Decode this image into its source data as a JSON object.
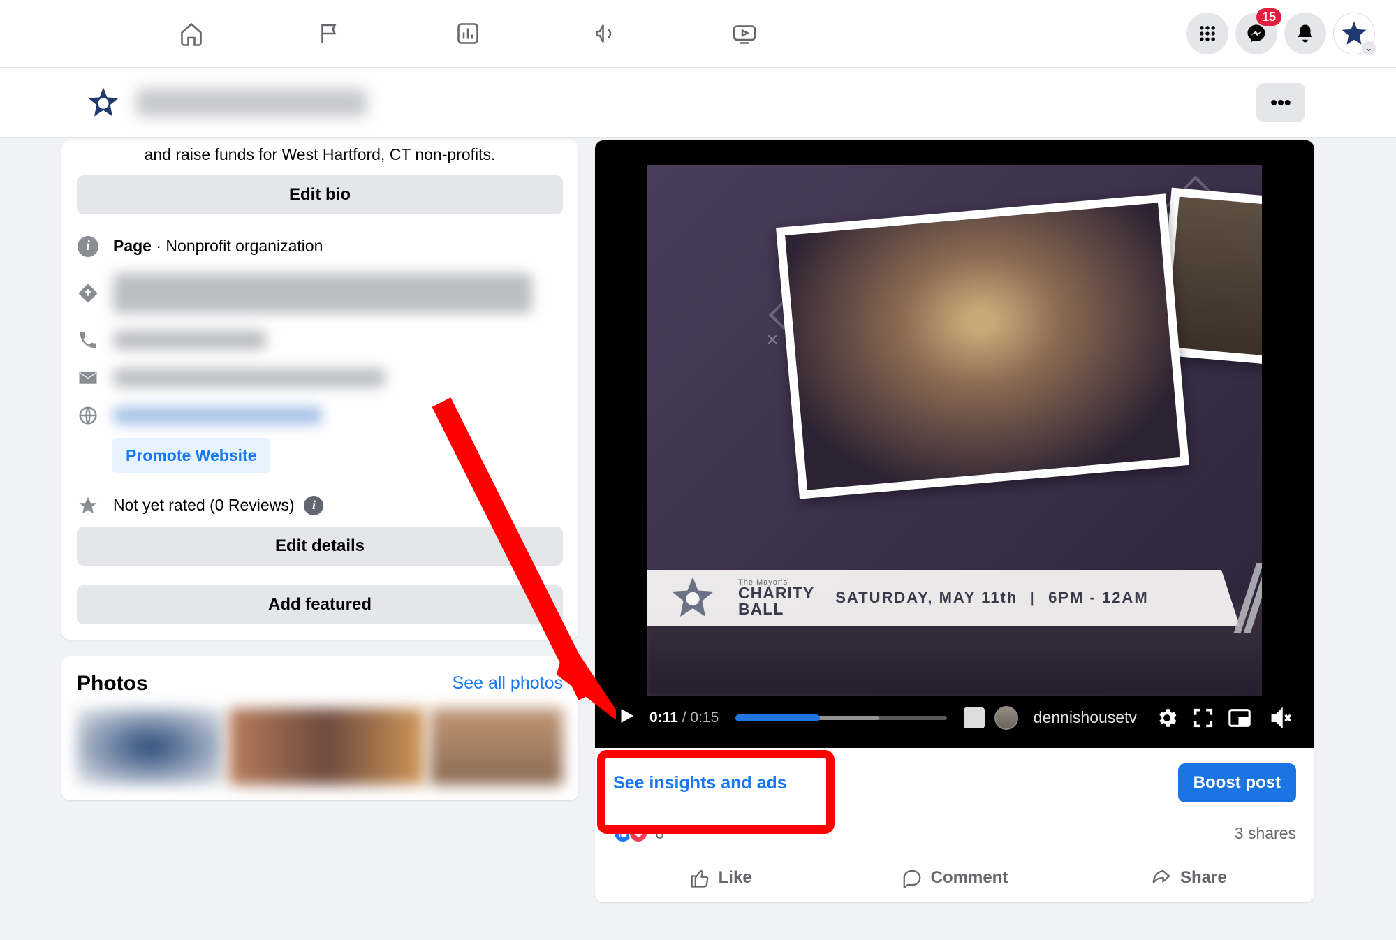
{
  "topnav": {
    "badge_count": "15"
  },
  "page_header": {
    "more_label": "•••"
  },
  "bio": {
    "text_line": "and raise funds for West Hartford, CT non-profits.",
    "edit_bio_label": "Edit bio"
  },
  "info": {
    "page_label_strong": "Page",
    "page_label_suffix": " · Nonprofit organization",
    "promote_website_label": "Promote Website",
    "rating_text": "Not yet rated (0 Reviews)",
    "edit_details_label": "Edit details",
    "add_featured_label": "Add featured"
  },
  "photos": {
    "title": "Photos",
    "see_all_label": "See all photos"
  },
  "video": {
    "banner_top_small": "The Mayor's",
    "banner_charity": "CHARITY",
    "banner_ball": "BALL",
    "banner_date": "SATURDAY, MAY 11th",
    "banner_time": "6PM - 12AM",
    "current_time": "0:11",
    "divider": " / ",
    "total_time": "0:15",
    "watermark": "dennishousetv"
  },
  "post": {
    "insights_label": "See insights and ads",
    "boost_label": "Boost post",
    "reaction_count": "6",
    "shares_text": "3 shares",
    "like_label": "Like",
    "comment_label": "Comment",
    "share_label": "Share"
  }
}
